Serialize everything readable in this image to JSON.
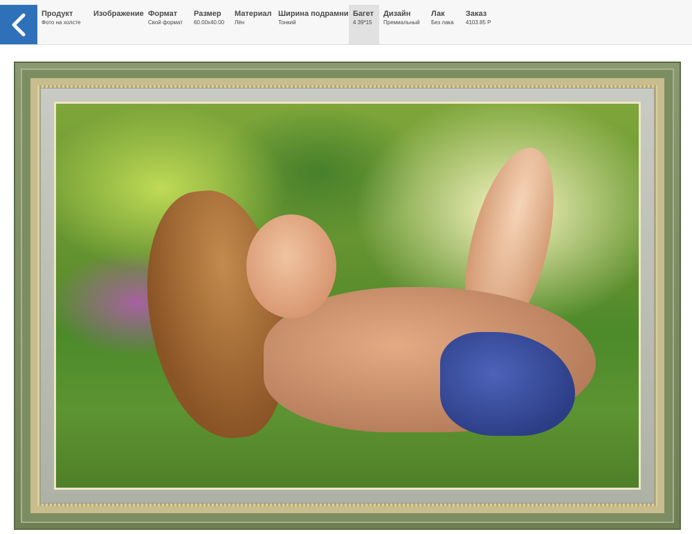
{
  "nav": {
    "back_icon": "chevron-left-icon",
    "steps": [
      {
        "title": "Продукт",
        "value": "Фото на холсте"
      },
      {
        "title": "Изображение",
        "value": ""
      },
      {
        "title": "Формат",
        "value": "Свой формат"
      },
      {
        "title": "Размер",
        "value": "60.00x40.00"
      },
      {
        "title": "Материал",
        "value": "Лён"
      },
      {
        "title": "Ширина подрамника",
        "value": "Тонкий"
      },
      {
        "title": "Багет",
        "value": "4 39*15"
      },
      {
        "title": "Дизайн",
        "value": "Премиальный"
      },
      {
        "title": "Лак",
        "value": "Без лака"
      },
      {
        "title": "Заказ",
        "value": "4103.85 Р"
      }
    ],
    "active_step": "Багет"
  },
  "colors": {
    "back_button": "#2f71b9",
    "active_step_bg": "#e1e1e1",
    "frame": "#7d8d62"
  }
}
